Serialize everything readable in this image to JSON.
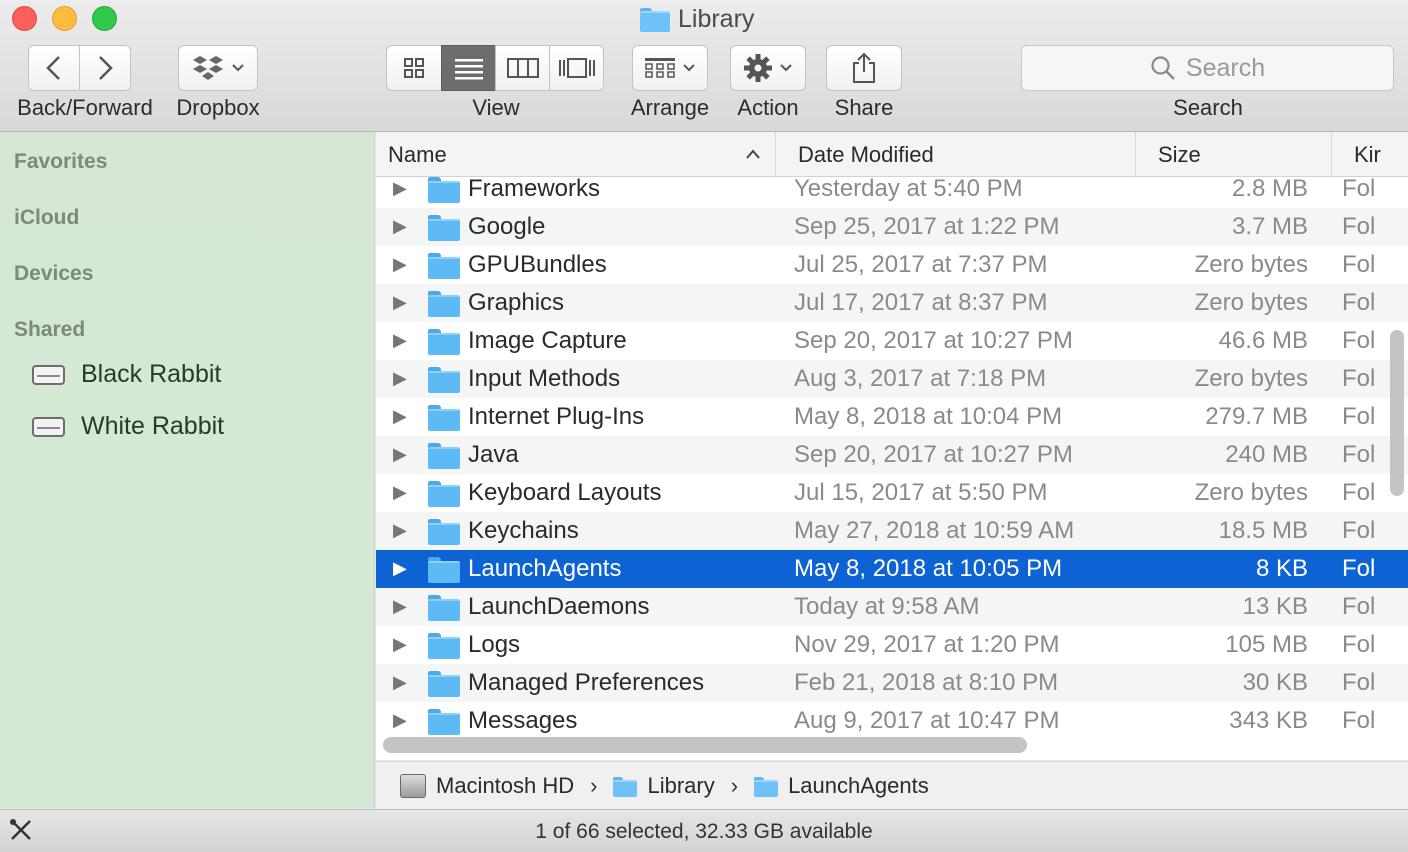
{
  "window": {
    "title": "Library"
  },
  "toolbar": {
    "back_forward_label": "Back/Forward",
    "dropbox_label": "Dropbox",
    "view_label": "View",
    "arrange_label": "Arrange",
    "action_label": "Action",
    "share_label": "Share",
    "search_label": "Search",
    "search_placeholder": "Search"
  },
  "sidebar": {
    "sections": [
      "Favorites",
      "iCloud",
      "Devices",
      "Shared"
    ],
    "shared_items": [
      {
        "label": "Black Rabbit"
      },
      {
        "label": "White Rabbit"
      }
    ]
  },
  "columns": {
    "name": "Name",
    "date": "Date Modified",
    "size": "Size",
    "kind": "Kir"
  },
  "rows": [
    {
      "name": "Frameworks",
      "date": "Yesterday at 5:40 PM",
      "size": "2.8 MB",
      "kind": "Fol"
    },
    {
      "name": "Google",
      "date": "Sep 25, 2017 at 1:22 PM",
      "size": "3.7 MB",
      "kind": "Fol"
    },
    {
      "name": "GPUBundles",
      "date": "Jul 25, 2017 at 7:37 PM",
      "size": "Zero bytes",
      "kind": "Fol"
    },
    {
      "name": "Graphics",
      "date": "Jul 17, 2017 at 8:37 PM",
      "size": "Zero bytes",
      "kind": "Fol"
    },
    {
      "name": "Image Capture",
      "date": "Sep 20, 2017 at 10:27 PM",
      "size": "46.6 MB",
      "kind": "Fol"
    },
    {
      "name": "Input Methods",
      "date": "Aug 3, 2017 at 7:18 PM",
      "size": "Zero bytes",
      "kind": "Fol"
    },
    {
      "name": "Internet Plug-Ins",
      "date": "May 8, 2018 at 10:04 PM",
      "size": "279.7 MB",
      "kind": "Fol"
    },
    {
      "name": "Java",
      "date": "Sep 20, 2017 at 10:27 PM",
      "size": "240 MB",
      "kind": "Fol"
    },
    {
      "name": "Keyboard Layouts",
      "date": "Jul 15, 2017 at 5:50 PM",
      "size": "Zero bytes",
      "kind": "Fol"
    },
    {
      "name": "Keychains",
      "date": "May 27, 2018 at 10:59 AM",
      "size": "18.5 MB",
      "kind": "Fol"
    },
    {
      "name": "LaunchAgents",
      "date": "May 8, 2018 at 10:05 PM",
      "size": "8 KB",
      "kind": "Fol",
      "selected": true
    },
    {
      "name": "LaunchDaemons",
      "date": "Today at 9:58 AM",
      "size": "13 KB",
      "kind": "Fol"
    },
    {
      "name": "Logs",
      "date": "Nov 29, 2017 at 1:20 PM",
      "size": "105 MB",
      "kind": "Fol"
    },
    {
      "name": "Managed Preferences",
      "date": "Feb 21, 2018 at 8:10 PM",
      "size": "30 KB",
      "kind": "Fol"
    },
    {
      "name": "Messages",
      "date": "Aug 9, 2017 at 10:47 PM",
      "size": "343 KB",
      "kind": "Fol"
    }
  ],
  "pathbar": {
    "segments": [
      "Macintosh HD",
      "Library",
      "LaunchAgents"
    ]
  },
  "status": {
    "text": "1 of 66 selected, 32.33 GB available"
  },
  "colors": {
    "selection": "#0d63d3",
    "sidebar": "#d4e8d4",
    "folder": "#6ec2f7"
  },
  "icons": [
    "back-icon",
    "forward-icon",
    "dropbox-icon",
    "icon-view-icon",
    "list-view-icon",
    "column-view-icon",
    "cover-flow-icon",
    "arrange-icon",
    "gear-icon",
    "share-icon",
    "search-icon",
    "folder-icon",
    "hard-drive-icon"
  ]
}
